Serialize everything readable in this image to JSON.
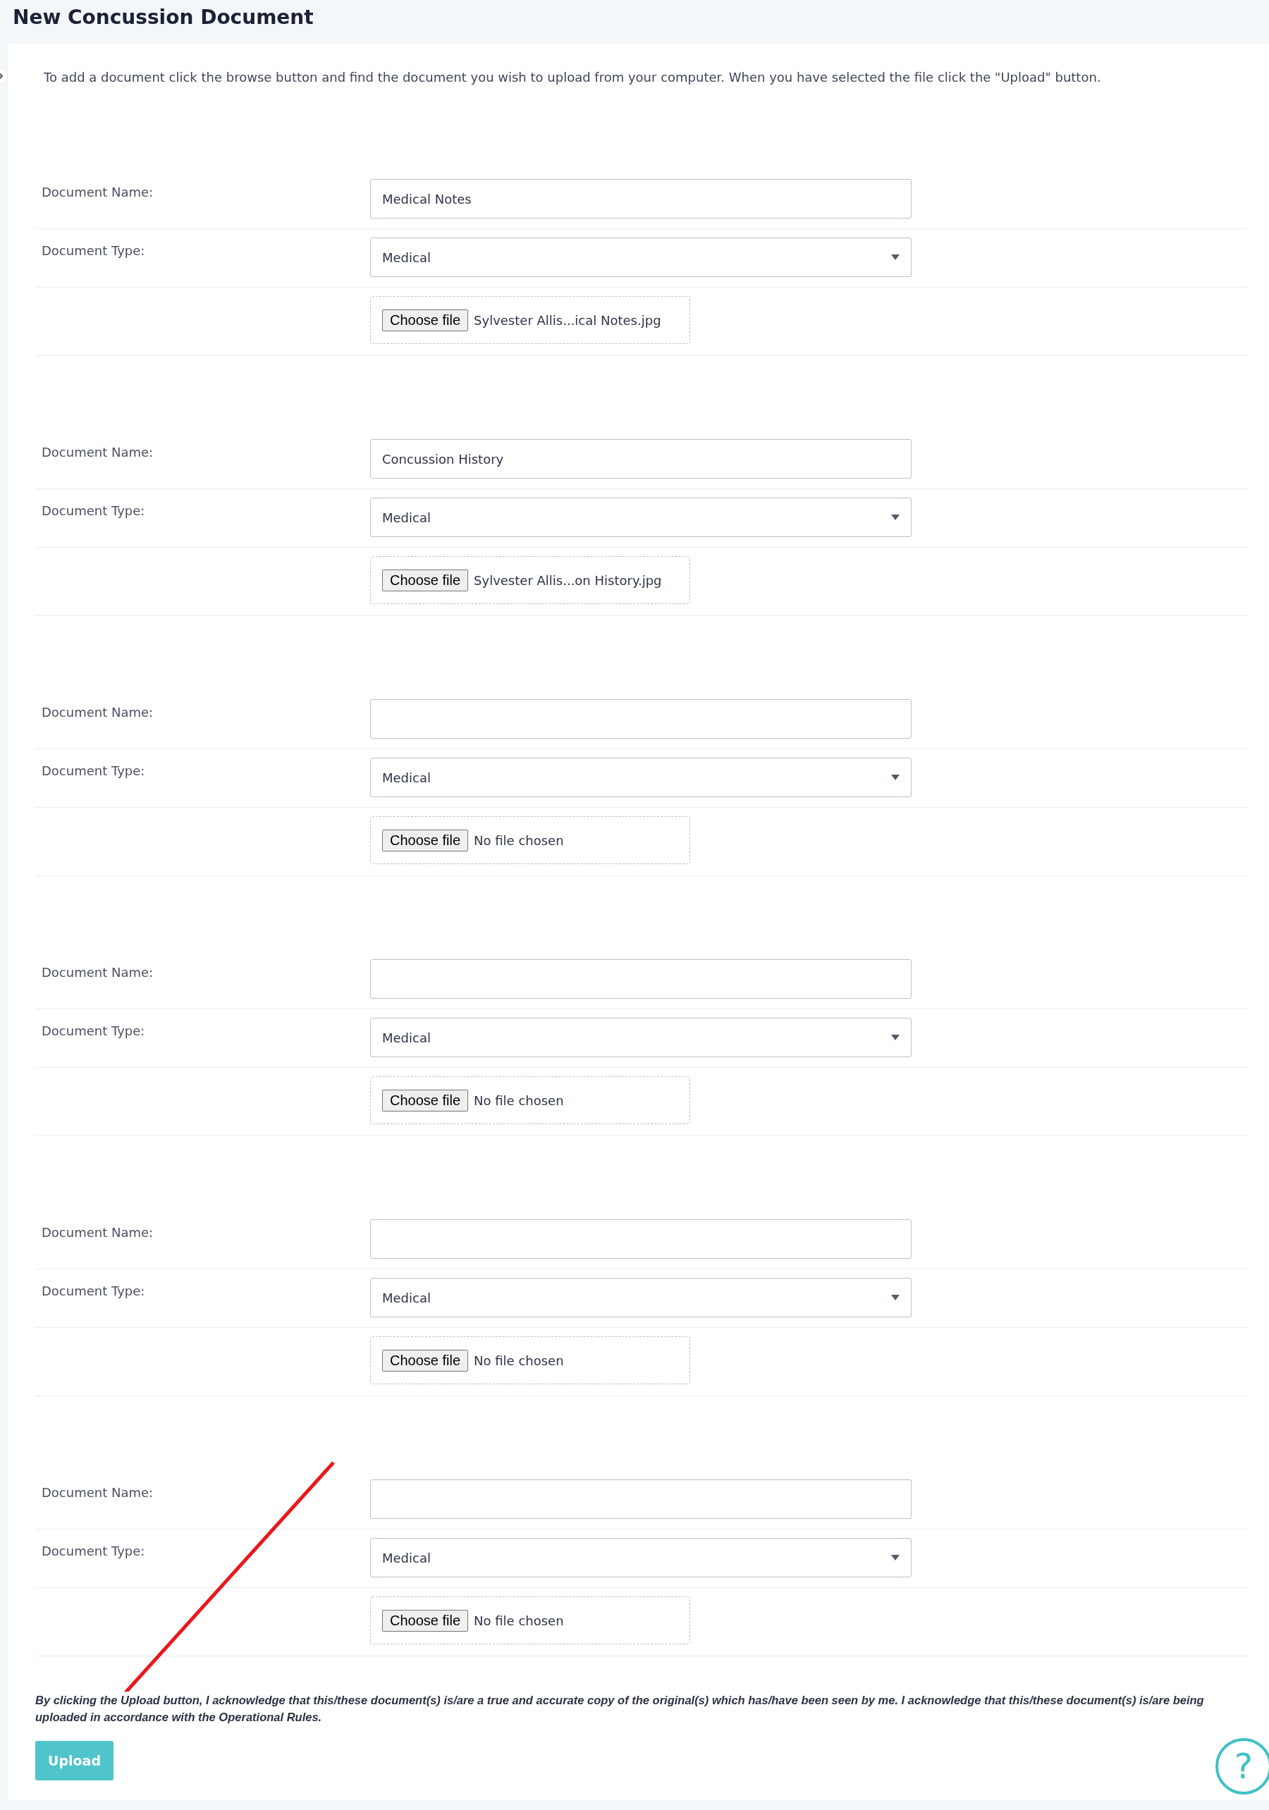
{
  "title": "New Concussion Document",
  "intro": "To add a document click the browse button and find the document you wish to upload from your computer. When you have selected the file click the \"Upload\" button.",
  "documents": [
    {
      "name_label": "Document Name:",
      "name_value": "Medical Notes",
      "type_label": "Document Type:",
      "type_value": "Medical",
      "file_button": "Choose file",
      "file_status": "Sylvester Allis...ical Notes.jpg"
    },
    {
      "name_label": "Document Name:",
      "name_value": "Concussion History",
      "type_label": "Document Type:",
      "type_value": "Medical",
      "file_button": "Choose file",
      "file_status": "Sylvester Allis...on History.jpg"
    },
    {
      "name_label": "Document Name:",
      "type_label": "Document Type:",
      "type_value": "Medical",
      "file_button": "Choose file",
      "file_status": "No file chosen"
    },
    {
      "name_label": "Document Name:",
      "type_label": "Document Type:",
      "type_value": "Medical",
      "file_button": "Choose file",
      "file_status": "No file chosen"
    },
    {
      "name_label": "Document Name:",
      "type_label": "Document Type:",
      "type_value": "Medical",
      "file_button": "Choose file",
      "file_status": "No file chosen"
    },
    {
      "name_label": "Document Name:",
      "type_label": "Document Type:",
      "type_value": "Medical",
      "file_button": "Choose file",
      "file_status": "No file chosen"
    }
  ],
  "disclaimer": "By clicking the Upload button, I acknowledge that this/these document(s) is/are a true and accurate copy of the original(s) which has/have been seen by me. I acknowledge that this/these document(s) is/are being uploaded in accordance with the Operational Rules.",
  "upload_button": "Upload",
  "help_button": "?"
}
